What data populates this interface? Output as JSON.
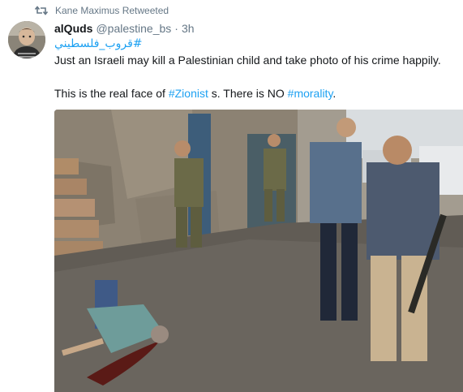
{
  "retweet": {
    "label": "Kane Maximus Retweeted",
    "icon": "retweet-icon"
  },
  "tweet": {
    "display_name": "alQuds",
    "screen_name": "@palestine_bs",
    "separator": "·",
    "time": "3h",
    "hashtag_arabic": "#قروب_فلسطيني",
    "line1": "Just an Israeli may kill a Palestinian child and take photo of his crime happily.",
    "line2_prefix": "This is the real face of ",
    "line2_tag1": "#Zionist",
    "line2_mid": " s. There is NO ",
    "line2_tag2": "#morality",
    "line2_suffix": "."
  },
  "colors": {
    "link": "#1da1f2",
    "muted": "#657786",
    "text": "#14171a"
  },
  "media": {
    "icon": "photo-image"
  }
}
